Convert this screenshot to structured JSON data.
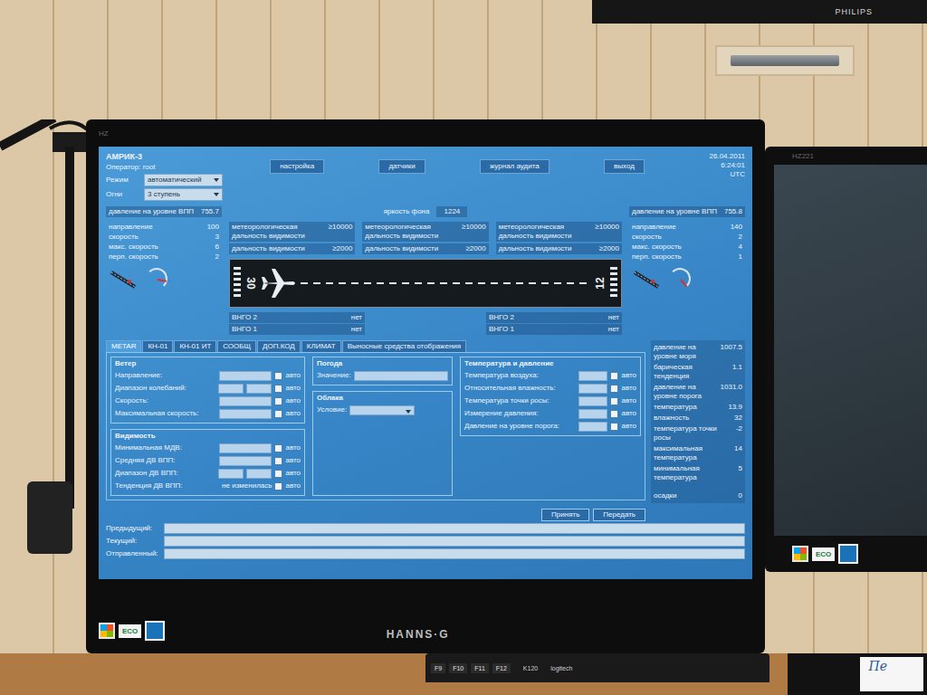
{
  "scene": {
    "tv_brand": "PHILIPS",
    "monitor_brand": "HANNS·G",
    "monitor_model": "HZ",
    "right_monitor_model": "HZ221",
    "badges": [
      "ECO",
      "ECO"
    ],
    "keyboard": {
      "keys": [
        "F9",
        "F10",
        "F11",
        "F12"
      ],
      "model": "K120",
      "maker": "logitech"
    },
    "note": "Пе"
  },
  "app": {
    "title": "АМРИК-3",
    "operator": "Оператор: root",
    "mode_label": "Режим",
    "mode_value": "автоматический",
    "lights_label": "Огни",
    "lights_value": "3 ступень",
    "nav": [
      "настройка",
      "датчики",
      "журнал аудита",
      "выход"
    ],
    "date": "26.04.2011",
    "time": "6:24:01",
    "tz": "UTC"
  },
  "brightness": {
    "label": "яркость фона",
    "value": "1224"
  },
  "visibility": [
    {
      "mor_label": "метеорологическая дальность видимости",
      "mor": "≥10000",
      "rvr_label": "дальность видимости",
      "rvr": "≥2000"
    },
    {
      "mor_label": "метеорологическая дальность видимости",
      "mor": "≥10000",
      "rvr_label": "дальность видимости",
      "rvr": "≥2000"
    },
    {
      "mor_label": "метеорологическая дальность видимости",
      "mor": "≥10000",
      "rvr_label": "дальность видимости",
      "rvr": "≥2000"
    }
  ],
  "ends": [
    {
      "pressure_label": "давление на уровне ВПП",
      "pressure": "755.7",
      "wind": [
        {
          "label": "направление",
          "value": "100"
        },
        {
          "label": "скорость",
          "value": "3"
        },
        {
          "label": "макс. скорость",
          "value": "6"
        },
        {
          "label": "перп. скорость",
          "value": "2"
        }
      ]
    },
    {
      "pressure_label": "давление на уровне ВПП",
      "pressure": "755.8",
      "wind": [
        {
          "label": "направление",
          "value": "140"
        },
        {
          "label": "скорость",
          "value": "2"
        },
        {
          "label": "макс. скорость",
          "value": "4"
        },
        {
          "label": "перп. скорость",
          "value": "1"
        }
      ]
    }
  ],
  "runway": {
    "left_number": "30",
    "right_number": "12"
  },
  "cloud_base_groups": [
    [
      {
        "label": "ВНГО 2",
        "value": "нет"
      },
      {
        "label": "ВНГО 1",
        "value": "нет"
      }
    ],
    [
      {
        "label": "ВНГО 2",
        "value": "нет"
      },
      {
        "label": "ВНГО 1",
        "value": "нет"
      }
    ]
  ],
  "tabs": [
    {
      "label": "METAR",
      "selected": true
    },
    {
      "label": "КН-01",
      "selected": false
    },
    {
      "label": "КН-01 ИТ",
      "selected": false
    },
    {
      "label": "СООБЩ",
      "selected": false
    },
    {
      "label": "ДОП.КОД",
      "selected": false
    },
    {
      "label": "КЛИМАТ",
      "selected": false
    },
    {
      "label": "Выносные средства отображения",
      "selected": false
    }
  ],
  "form": {
    "auto_label": "авто",
    "wind": {
      "title": "Ветер",
      "rows": [
        {
          "label": "Направление:",
          "kind": "single",
          "auto": false
        },
        {
          "label": "Диапазон колебаний:",
          "kind": "range",
          "auto": false
        },
        {
          "label": "Скорость:",
          "kind": "single",
          "auto": false
        },
        {
          "label": "Максимальная скорость:",
          "kind": "single",
          "auto": false
        }
      ]
    },
    "visibility": {
      "title": "Видимость",
      "rows": [
        {
          "label": "Минимальная МДВ:",
          "kind": "single",
          "auto": false
        },
        {
          "label": "Средняя ДВ ВПП:",
          "kind": "single",
          "auto": false
        },
        {
          "label": "Диапазон ДВ ВПП:",
          "kind": "range",
          "auto": false
        }
      ],
      "tendency_label": "Тенденция ДВ ВПП:",
      "tendency_value": "не изменилась",
      "tendency_auto": false
    },
    "weather": {
      "title": "Погода",
      "label": "Значение:"
    },
    "clouds": {
      "title": "Облака",
      "label": "Условие:"
    },
    "temperature": {
      "title": "Температура и давление",
      "rows": [
        {
          "label": "Температура воздуха:",
          "auto": false
        },
        {
          "label": "Относительная влажность:",
          "auto": false
        },
        {
          "label": "Температура точки росы:",
          "auto": false
        },
        {
          "label": "Измерение давления:",
          "auto": false
        },
        {
          "label": "Давление на уровне порога:",
          "auto": false
        }
      ]
    }
  },
  "sensors": [
    {
      "label": "давление на уровне моря",
      "value": "1007.5"
    },
    {
      "label": "барическая тенденция",
      "value": "1.1"
    },
    {
      "label": "давление на уровне порога",
      "value": "1031.0"
    },
    {
      "label": "температура",
      "value": "13.9"
    },
    {
      "label": "влажность",
      "value": "32"
    },
    {
      "label": "температура точки росы",
      "value": "-2"
    },
    {
      "label": "максимальная температура",
      "value": "14"
    },
    {
      "label": "минимальная температура",
      "value": "5"
    }
  ],
  "precipitation": {
    "label": "осадки",
    "value": "0"
  },
  "buttons": [
    "Принять",
    "Передать"
  ],
  "messages": [
    {
      "label": "Предыдущий:"
    },
    {
      "label": "Текущий:"
    },
    {
      "label": "Отправленный:"
    }
  ]
}
